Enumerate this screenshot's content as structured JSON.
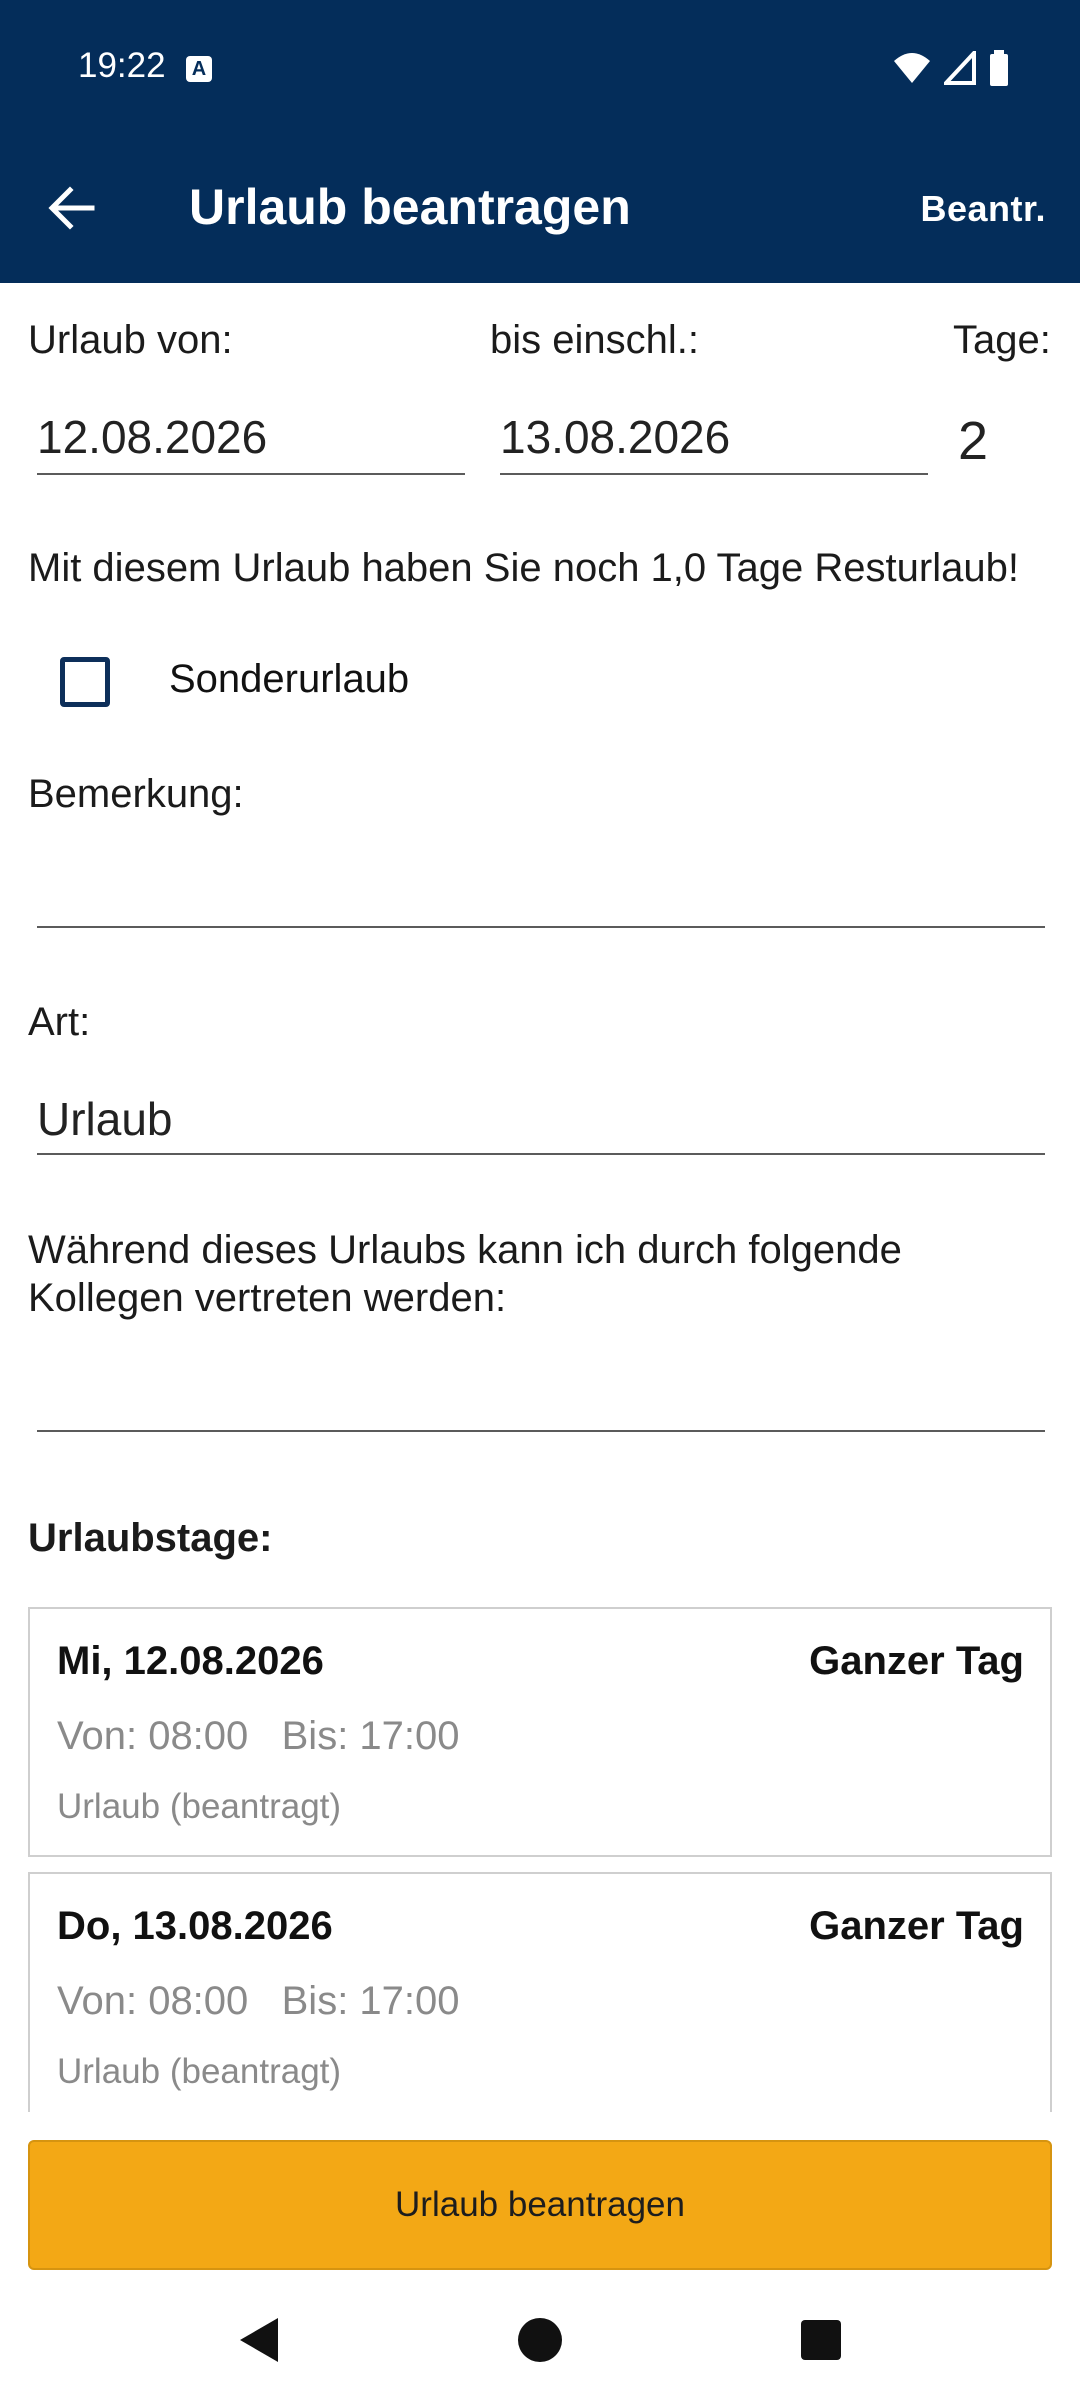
{
  "status_bar": {
    "time": "19:22",
    "a_badge": "A"
  },
  "app_bar": {
    "title": "Urlaub beantragen",
    "action": "Beantr."
  },
  "form": {
    "from_label": "Urlaub von:",
    "to_label": "bis einschl.:",
    "days_label": "Tage:",
    "from_value": "12.08.2026",
    "to_value": "13.08.2026",
    "days_value": "2",
    "remaining_text": "Mit diesem Urlaub haben Sie noch 1,0 Tage Resturlaub!",
    "special_leave_label": "Sonderurlaub",
    "remark_label": "Bemerkung:",
    "remark_value": "",
    "type_label": "Art:",
    "type_value": "Urlaub",
    "substitute_text_line1": "Während dieses Urlaubs kann ich durch folgende",
    "substitute_text_line2": "Kollegen vertreten werden:",
    "substitute_value": ""
  },
  "days_section": {
    "title": "Urlaubstage:",
    "items": [
      {
        "date": "Mi, 12.08.2026",
        "duration": "Ganzer Tag",
        "times": "Von: 08:00   Bis: 17:00",
        "status": "Urlaub (beantragt)"
      },
      {
        "date": "Do, 13.08.2026",
        "duration": "Ganzer Tag",
        "times": "Von: 08:00   Bis: 17:00",
        "status": "Urlaub (beantragt)"
      }
    ]
  },
  "submit_button": "Urlaub beantragen",
  "colors": {
    "app_bar": "#042d5a",
    "accent_button": "#f3a815"
  },
  "icons": [
    "back-arrow-icon",
    "wifi-icon",
    "signal-icon",
    "battery-icon",
    "nav-back-icon",
    "nav-home-icon",
    "nav-recents-icon"
  ]
}
